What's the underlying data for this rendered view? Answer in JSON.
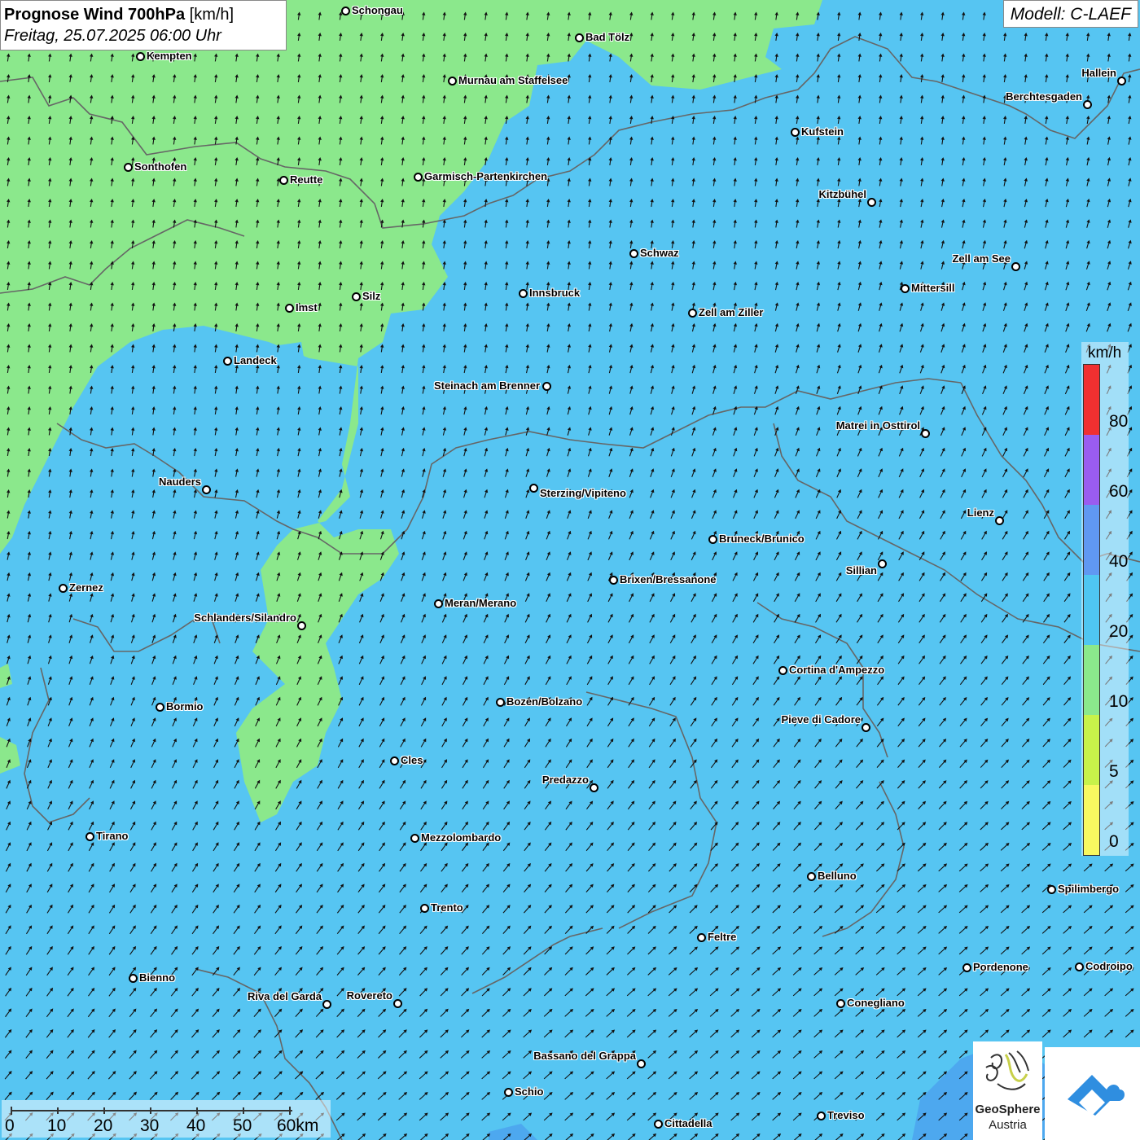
{
  "title": {
    "main": "Prognose Wind 700hPa",
    "unit": "[km/h]",
    "datetime": "Freitag, 25.07.2025 06:00 Uhr"
  },
  "model": "Modell: C-LAEF",
  "colors": {
    "wind_10_20": "#56c5f2",
    "wind_5_10": "#8be88c",
    "water": "#4da8ef",
    "border": "#666666"
  },
  "legend": {
    "unit": "km/h",
    "ticks": [
      "80",
      "60",
      "40",
      "20",
      "10",
      "5",
      "0"
    ],
    "colors": [
      "#f03030",
      "#9a5cf0",
      "#6098f2",
      "#4fc6f2",
      "#8be88c",
      "#c8f24a",
      "#f8f860"
    ]
  },
  "scalebar": {
    "labels": [
      "0",
      "10",
      "20",
      "30",
      "40",
      "50",
      "60km"
    ]
  },
  "logo": {
    "name_line1": "GeoSphere",
    "name_line2": "Austria"
  },
  "cities": [
    {
      "name": "Schongau"
    },
    {
      "name": "Bad Tölz"
    },
    {
      "name": "Kempten"
    },
    {
      "name": "Murnau am Staffelsee"
    },
    {
      "name": "Hallein"
    },
    {
      "name": "Berchtesgaden"
    },
    {
      "name": "Kufstein"
    },
    {
      "name": "Sonthofen"
    },
    {
      "name": "Reutte"
    },
    {
      "name": "Garmisch-Partenkirchen"
    },
    {
      "name": "Kitzbühel"
    },
    {
      "name": "Schwaz"
    },
    {
      "name": "Zell am See"
    },
    {
      "name": "Mittersill"
    },
    {
      "name": "Innsbruck"
    },
    {
      "name": "Silz"
    },
    {
      "name": "Imst"
    },
    {
      "name": "Zell am Ziller"
    },
    {
      "name": "Landeck"
    },
    {
      "name": "Steinach am Brenner"
    },
    {
      "name": "Matrei in Osttirol"
    },
    {
      "name": "Nauders"
    },
    {
      "name": "Sterzing/Vipiteno"
    },
    {
      "name": "Lienz"
    },
    {
      "name": "Bruneck/Brunico"
    },
    {
      "name": "Sillian"
    },
    {
      "name": "Brixen/Bressanone"
    },
    {
      "name": "Zernez"
    },
    {
      "name": "Meran/Merano"
    },
    {
      "name": "Schlanders/Silandro"
    },
    {
      "name": "Cortina d'Ampezzo"
    },
    {
      "name": "Bozen/Bolzano"
    },
    {
      "name": "Bormio"
    },
    {
      "name": "Pieve di Cadore"
    },
    {
      "name": "Cles"
    },
    {
      "name": "Predazzo"
    },
    {
      "name": "Tirano"
    },
    {
      "name": "Mezzolombardo"
    },
    {
      "name": "Belluno"
    },
    {
      "name": "Spilimbergo"
    },
    {
      "name": "Trento"
    },
    {
      "name": "Feltre"
    },
    {
      "name": "Bienno"
    },
    {
      "name": "Pordenone"
    },
    {
      "name": "Codroipo"
    },
    {
      "name": "Riva del Garda"
    },
    {
      "name": "Rovereto"
    },
    {
      "name": "Conegliano"
    },
    {
      "name": "Bassano del Grappa"
    },
    {
      "name": "Schio"
    },
    {
      "name": "Treviso"
    },
    {
      "name": "Cittadella"
    }
  ]
}
